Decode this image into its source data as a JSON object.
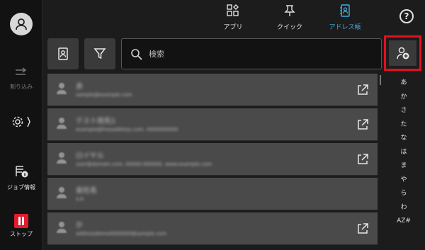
{
  "sidebar": {
    "interrupt_label": "割り込み",
    "job_info_label": "ジョブ情報",
    "stop_label": "ストップ"
  },
  "tabs": [
    {
      "label": "アプリ",
      "icon": "apps-grid-icon",
      "active": false
    },
    {
      "label": "クイック",
      "icon": "pushpin-icon",
      "active": false
    },
    {
      "label": "アドレス帳",
      "icon": "address-book-icon",
      "active": true
    }
  ],
  "colors": {
    "accent": "#3fb0e3",
    "highlight_border": "#e01020",
    "stop_red": "#e21b2e"
  },
  "search": {
    "placeholder": "検索"
  },
  "index": [
    "あ",
    "か",
    "さ",
    "た",
    "な",
    "は",
    "ま",
    "や",
    "ら",
    "わ",
    "AZ#"
  ],
  "contacts": [
    {
      "name": "あ",
      "detail": "sample@example.com",
      "has_link": true
    },
    {
      "name": "テスト宛先1",
      "detail": "example@freeaddress.com, 0000000000",
      "has_link": true
    },
    {
      "name": "ロイヤル",
      "detail": "user@domain.com, 00000-000000, www.example.com",
      "has_link": true
    },
    {
      "name": "会社名",
      "detail": "a.b",
      "has_link": false
    },
    {
      "name": "か",
      "detail": "addressdemo0000000@sample.com",
      "has_link": true
    }
  ]
}
